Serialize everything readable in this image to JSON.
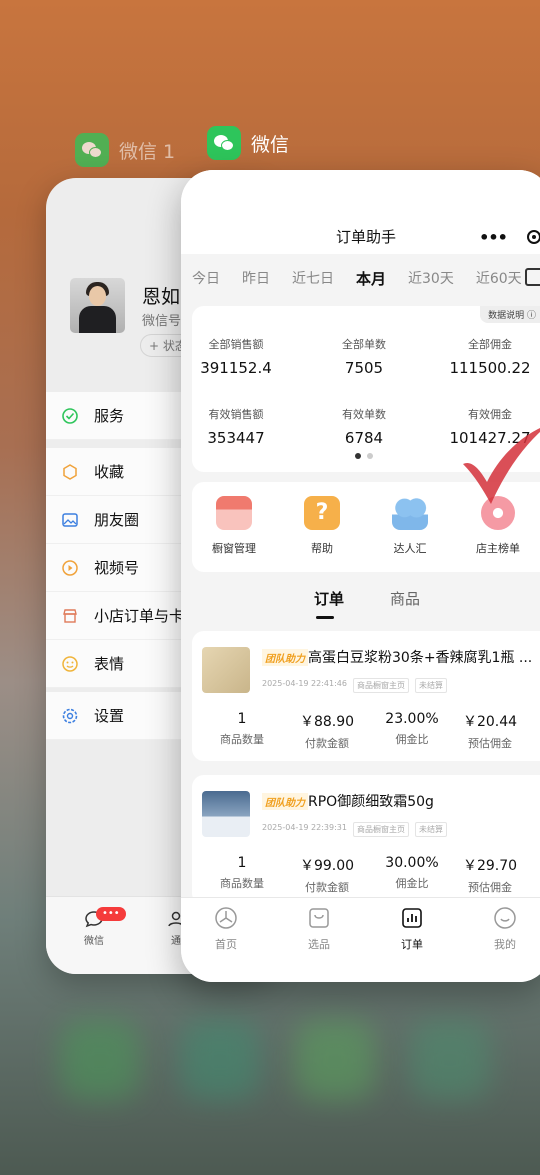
{
  "back_app": {
    "label": "微信 1",
    "profile": {
      "name": "恩如",
      "wechat_id_prefix": "微信号",
      "status": "+ 状态"
    },
    "menu": [
      {
        "icon": "service-icon",
        "label": "服务"
      },
      {
        "icon": "favorites-icon",
        "label": "收藏"
      },
      {
        "icon": "moments-icon",
        "label": "朋友圈"
      },
      {
        "icon": "channels-icon",
        "label": "视频号"
      },
      {
        "icon": "shop-icon",
        "label": "小店订单与卡"
      },
      {
        "icon": "emoji-icon",
        "label": "表情"
      },
      {
        "icon": "settings-icon",
        "label": "设置"
      }
    ],
    "tabbar": {
      "chat_label": "微信",
      "chat_badge": "•••",
      "contacts_label": "通"
    }
  },
  "front_app": {
    "label": "微信",
    "nav_title": "订单助手",
    "date_tabs": [
      "今日",
      "昨日",
      "近七日",
      "本月",
      "近30天",
      "近60天"
    ],
    "active_date_tab": "本月",
    "help_chip": "数据说明 ⓘ",
    "stats": [
      {
        "label": "全部销售额",
        "value": "391152.4"
      },
      {
        "label": "全部单数",
        "value": "7505"
      },
      {
        "label": "全部佣金",
        "value": "111500.22"
      },
      {
        "label": "有效销售额",
        "value": "353447"
      },
      {
        "label": "有效单数",
        "value": "6784"
      },
      {
        "label": "有效佣金",
        "value": "101427.27"
      }
    ],
    "tools": [
      {
        "icon": "storefront-icon",
        "label": "橱窗管理",
        "color": "#f0857a"
      },
      {
        "icon": "help-icon",
        "label": "帮助",
        "color": "#f6b04a"
      },
      {
        "icon": "talent-icon",
        "label": "达人汇",
        "color": "#7fb7ea"
      },
      {
        "icon": "ranking-icon",
        "label": "店主榜单",
        "color": "#f59aa4"
      }
    ],
    "segments": {
      "orders": "订单",
      "products": "商品"
    },
    "orders": [
      {
        "tag": "团队助力",
        "title": "高蛋白豆浆粉30条+香辣腐乳1瓶 ...",
        "time": "2025-04-19 22:41:46",
        "source": "商品橱窗主页",
        "settle": "未结算",
        "qty": "1",
        "pay": "￥88.90",
        "rate": "23.00%",
        "commission": "￥20.44"
      },
      {
        "tag": "团队助力",
        "title": "RPO御颜细致霜50g",
        "time": "2025-04-19 22:39:31",
        "source": "商品橱窗主页",
        "settle": "未结算",
        "qty": "1",
        "pay": "￥99.00",
        "rate": "30.00%",
        "commission": "￥29.70"
      }
    ],
    "order_labels": {
      "qty": "商品数量",
      "pay": "付款金额",
      "rate": "佣金比",
      "commission": "预估佣金"
    },
    "tabbar": [
      {
        "icon": "home-icon",
        "label": "首页"
      },
      {
        "icon": "selection-bag-icon",
        "label": "选品"
      },
      {
        "icon": "orders-chart-icon",
        "label": "订单"
      },
      {
        "icon": "profile-icon",
        "label": "我的"
      }
    ]
  }
}
